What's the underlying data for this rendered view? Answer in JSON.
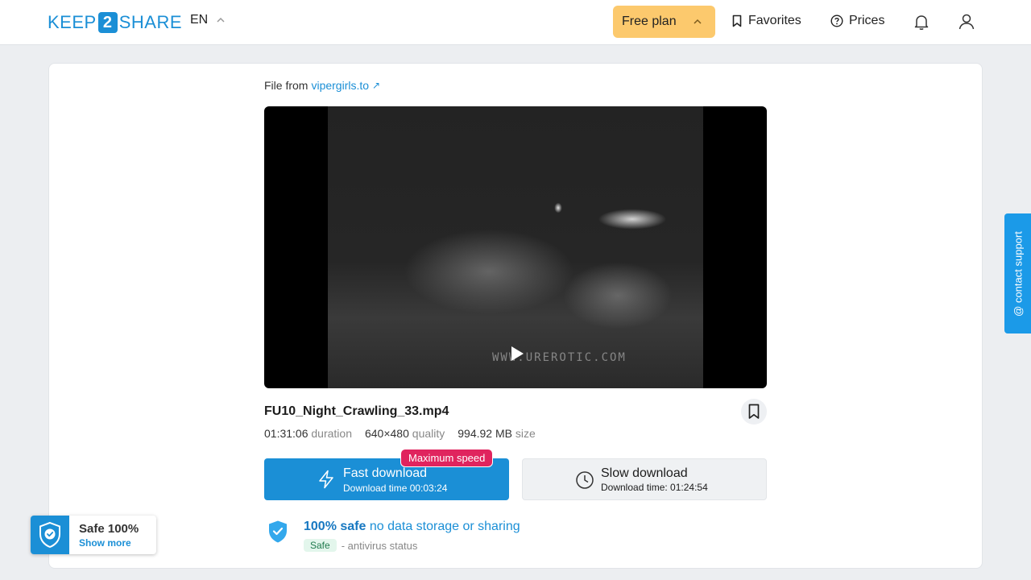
{
  "header": {
    "logo_left": "KEEP",
    "logo_mid": "2",
    "logo_right": "SHARE",
    "language": "EN",
    "plan_label": "Free plan",
    "favorites_label": "Favorites",
    "prices_label": "Prices"
  },
  "file": {
    "source_prefix": "File from",
    "source_link": "vipergirls.to",
    "source_arrow": "↗",
    "name": "FU10_Night_Crawling_33.mp4",
    "duration": "01:31:06",
    "duration_label": "duration",
    "quality": "640×480",
    "quality_label": "quality",
    "size": "994.92 MB",
    "size_label": "size",
    "watermark": "WWW.URЕROTIC.COM"
  },
  "download": {
    "fast_label": "Fast download",
    "fast_time": "Download time 00:03:24",
    "max_speed_badge": "Maximum speed",
    "slow_label": "Slow download",
    "slow_time": "Download time: 01:24:54"
  },
  "safety": {
    "bold": "100% safe",
    "rest": "no data storage or sharing",
    "status_pill": "Safe",
    "status_text": "- antivirus status"
  },
  "safe_widget": {
    "title": "Safe 100%",
    "link": "Show more"
  },
  "support": {
    "label": "@ contact support"
  },
  "colors": {
    "brand": "#1b8fd6",
    "plan": "#fcc96d",
    "badge": "#e0245e"
  }
}
